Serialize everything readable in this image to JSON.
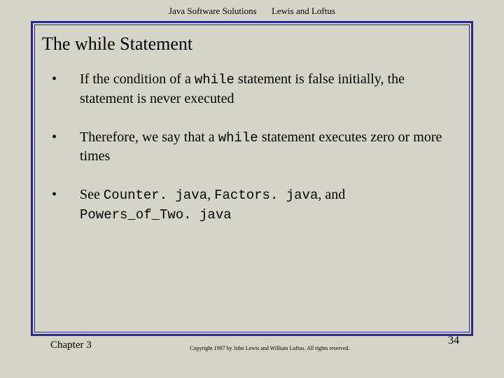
{
  "header": {
    "book_title": "Java Software Solutions",
    "authors": "Lewis and Loftus"
  },
  "slide": {
    "title": "The while Statement",
    "bullets": [
      {
        "pre": "If the condition of a ",
        "code1": "while",
        "mid": " statement is false initially, the statement is never executed",
        "code2": "",
        "code3": "",
        "tail": ""
      },
      {
        "pre": "Therefore, we say that a ",
        "code1": "while",
        "mid": " statement executes zero or more times",
        "code2": "",
        "code3": "",
        "tail": ""
      },
      {
        "pre": "See ",
        "code1": "Counter. java",
        "mid": ", ",
        "code2": "Factors. java",
        "mid2": ", and ",
        "code3": "Powers_of_Two. java",
        "tail": ""
      }
    ]
  },
  "footer": {
    "chapter": "Chapter 3",
    "copyright": "Copyright 1997 by John Lewis and William Loftus. All rights reserved.",
    "page_number": "34"
  }
}
